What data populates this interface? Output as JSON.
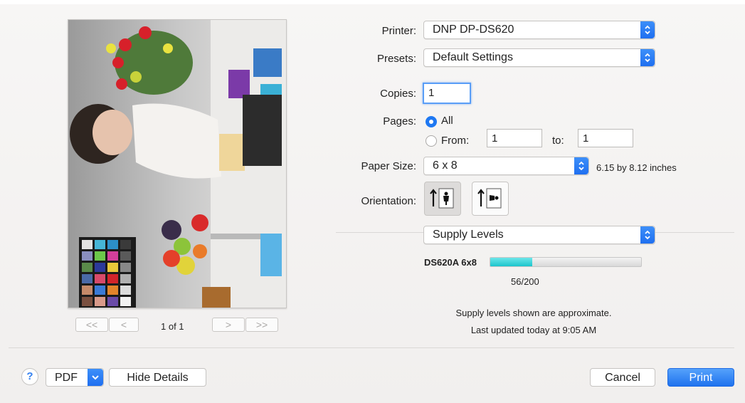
{
  "preview": {
    "page_label": "1 of 1"
  },
  "pager": {
    "first": "<<",
    "prev": "<",
    "next": ">",
    "last": ">>"
  },
  "printer": {
    "label": "Printer:",
    "value": "DNP DP-DS620"
  },
  "presets": {
    "label": "Presets:",
    "value": "Default Settings"
  },
  "copies": {
    "label": "Copies:",
    "value": "1"
  },
  "pages": {
    "label": "Pages:",
    "all_label": "All",
    "from_label": "From:",
    "from_value": "1",
    "to_label": "to:",
    "to_value": "1"
  },
  "paper_size": {
    "label": "Paper Size:",
    "value": "6 x 8",
    "dimensions": "6.15 by 8.12 inches"
  },
  "orientation": {
    "label": "Orientation:"
  },
  "section": {
    "value": "Supply Levels"
  },
  "supply": {
    "item_label": "DS620A 6x8",
    "count_text": "56/200",
    "level_fraction": 0.28,
    "bar_color": "#1cc5cc",
    "note_line1": "Supply levels shown are approximate.",
    "note_line2": "Last updated today at 9:05 AM"
  },
  "footer": {
    "help": "?",
    "pdf": "PDF",
    "hide_details": "Hide Details",
    "cancel": "Cancel",
    "print": "Print"
  },
  "colors": {
    "accent": "#1f72ee"
  }
}
